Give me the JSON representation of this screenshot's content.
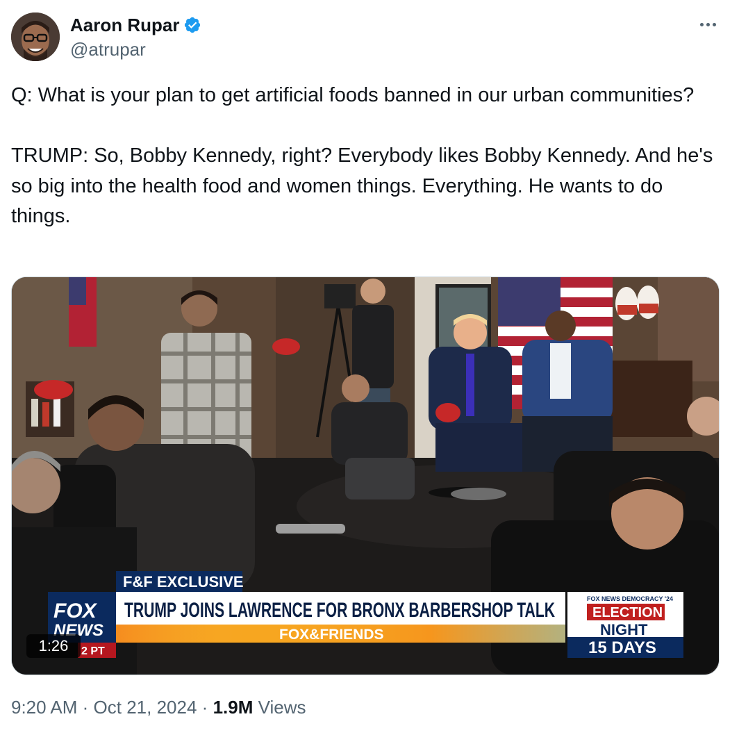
{
  "author": {
    "name": "Aaron Rupar",
    "handle": "@atrupar",
    "verified": true,
    "verified_color": "#1d9bf0"
  },
  "menu": {
    "icon": "more-options-icon"
  },
  "tweet": {
    "paragraphs": [
      "Q: What is your plan to get artificial foods banned in our urban communities?",
      "TRUMP: So, Bobby Kennedy, right? Everybody likes Bobby Kennedy. And he's so big into the health food and women things. Everything. He wants to do things."
    ]
  },
  "media": {
    "duration": "1:26",
    "chyron": {
      "tag": "F&F EXCLUSIVE",
      "headline": "TRUMP JOINS LAWRENCE FOR BRONX BARBERSHOP TALK",
      "show": "FOX&FRIENDS",
      "network_line1": "FOX",
      "network_line2": "NEWS",
      "time": "2 PT",
      "sidebar_top": "FOX NEWS DEMOCRACY '24",
      "sidebar_line1": "ELECTION",
      "sidebar_line2": "NIGHT",
      "sidebar_line3": "15 DAYS"
    }
  },
  "meta": {
    "time": "9:20 AM",
    "date": "Oct 21, 2024",
    "views_count": "1.9M",
    "views_label": "Views",
    "separator": "·"
  }
}
